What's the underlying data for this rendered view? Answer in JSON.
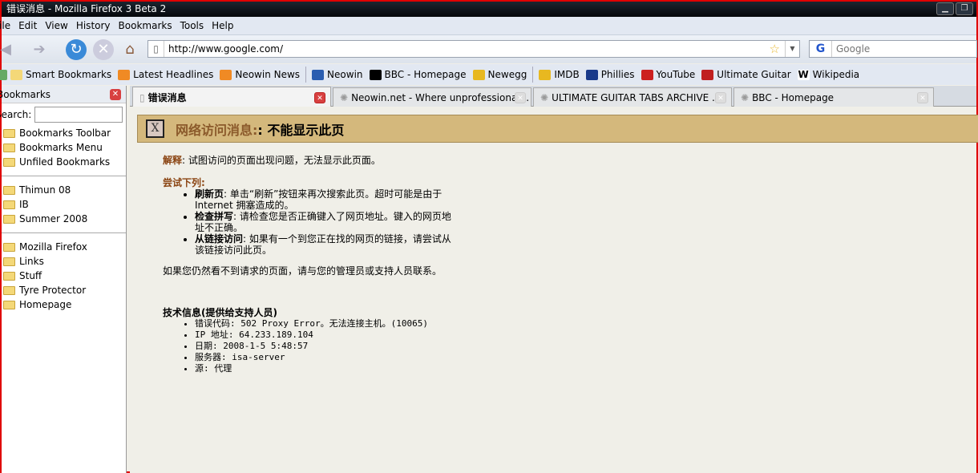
{
  "window": {
    "title": "错误消息 - Mozilla Firefox 3 Beta 2"
  },
  "menu": [
    "File",
    "Edit",
    "View",
    "History",
    "Bookmarks",
    "Tools",
    "Help"
  ],
  "nav": {
    "url": "http://www.google.com/",
    "search_placeholder": "Google"
  },
  "bookmarks_bar": [
    {
      "label": "Smart Bookmarks",
      "icon": "folder-icon",
      "color": "#f4d878"
    },
    {
      "label": "Latest Headlines",
      "icon": "rss-icon",
      "color": "#f08a24"
    },
    {
      "label": "Neowin News",
      "icon": "rss-icon",
      "color": "#f08a24"
    },
    {
      "label": "Neowin",
      "icon": "neowin-icon",
      "color": "#2a5db0"
    },
    {
      "label": "BBC - Homepage",
      "icon": "bbc-icon",
      "color": "#000000"
    },
    {
      "label": "Newegg",
      "icon": "newegg-icon",
      "color": "#e8b820"
    },
    {
      "label": "IMDB",
      "icon": "imdb-icon",
      "color": "#e8b820"
    },
    {
      "label": "Phillies",
      "icon": "mlb-icon",
      "color": "#1a3a8a"
    },
    {
      "label": "YouTube",
      "icon": "youtube-icon",
      "color": "#cc2020"
    },
    {
      "label": "Ultimate Guitar",
      "icon": "guitar-icon",
      "color": "#c02020"
    },
    {
      "label": "Wikipedia",
      "icon": "wikipedia-icon",
      "color": "#ffffff"
    }
  ],
  "sidebar": {
    "title": "Bookmarks",
    "search_label": "Search:",
    "groups": [
      [
        "Bookmarks Toolbar",
        "Bookmarks Menu",
        "Unfiled Bookmarks"
      ],
      [
        "Thimun 08",
        "IB",
        "Summer 2008"
      ],
      [
        "Mozilla Firefox",
        "Links",
        "Stuff",
        "Tyre Protector",
        "Homepage"
      ]
    ]
  },
  "tabs": [
    {
      "label": "错误消息",
      "active": true
    },
    {
      "label": "Neowin.net - Where unprofessional...",
      "active": false
    },
    {
      "label": "ULTIMATE GUITAR TABS ARCHIVE ...",
      "active": false
    },
    {
      "label": "BBC - Homepage",
      "active": false
    }
  ],
  "page": {
    "banner_icon": "X",
    "banner_title": "网络访问消息:",
    "banner_subtitle": ": 不能显示此页",
    "explain_label": "解释",
    "explain_text": ": 试图访问的页面出现问题，无法显示此页面。",
    "try_label": "尝试下列",
    "try_colon": ":",
    "tries": [
      {
        "b": "刷新页",
        "t": ": 单击“刷新”按钮来再次搜索此页。超时可能是由于 Internet 拥塞造成的。"
      },
      {
        "b": "检查拼写",
        "t": ": 请检查您是否正确键入了网页地址。键入的网页地址不正确。"
      },
      {
        "b": "从链接访问",
        "t": ": 如果有一个到您正在找的网页的链接，请尝试从该链接访问此页。"
      }
    ],
    "contact": "如果您仍然看不到请求的页面，请与您的管理员或支持人员联系。",
    "tech_title": "技术信息(提供给支持人员)",
    "tech": [
      "错误代码: 502 Proxy Error。无法连接主机。(10065)",
      "IP 地址: 64.233.189.104",
      "日期: 2008-1-5 5:48:57",
      "服务器: isa-server",
      "源: 代理"
    ]
  }
}
